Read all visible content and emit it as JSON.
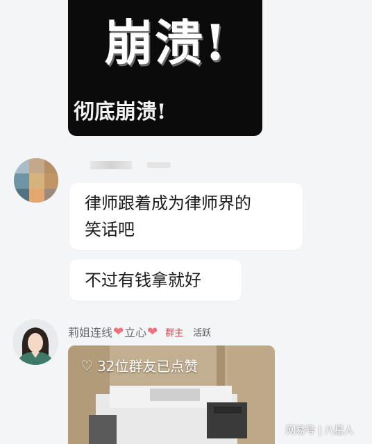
{
  "sticker": {
    "big_text": "崩溃!",
    "small_text": "彻底崩溃!"
  },
  "messages": [
    {
      "lines": [
        "律师跟着成为律师界的",
        "笑话吧"
      ]
    },
    {
      "lines": [
        "不过有钱拿就好"
      ]
    }
  ],
  "sender": {
    "name": "莉姐连线",
    "heart": "❤",
    "middle": "立心",
    "role": "群主",
    "status": "活跃"
  },
  "photo_message": {
    "likes_icon": "heart-outline-icon",
    "likes_text": "32位群友已点赞"
  },
  "watermark": "网易号 | 八星人",
  "colors": {
    "page_bg": "#f4f5f7",
    "bubble_bg": "#ffffff",
    "role_badge": "#d84949",
    "heart": "#ef6f7a"
  }
}
